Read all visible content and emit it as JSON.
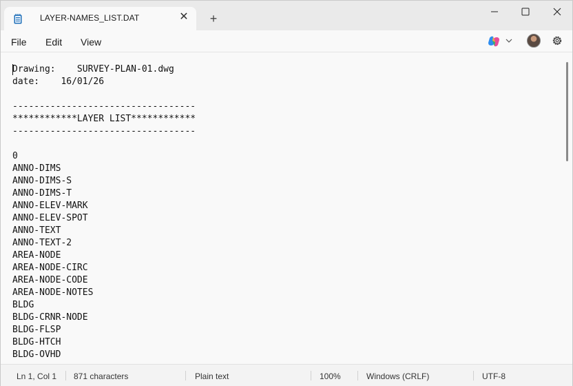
{
  "tab": {
    "title": "LAYER-NAMES_LIST.DAT",
    "close_glyph": "✕",
    "new_tab_glyph": "+"
  },
  "menu": {
    "file": "File",
    "edit": "Edit",
    "view": "View"
  },
  "document": {
    "lines": [
      "Drawing:    SURVEY-PLAN-01.dwg",
      "date:    16/01/26",
      "",
      "----------------------------------",
      "************LAYER LIST************",
      "----------------------------------",
      "",
      "0",
      "ANNO-DIMS",
      "ANNO-DIMS-S",
      "ANNO-DIMS-T",
      "ANNO-ELEV-MARK",
      "ANNO-ELEV-SPOT",
      "ANNO-TEXT",
      "ANNO-TEXT-2",
      "AREA-NODE",
      "AREA-NODE-CIRC",
      "AREA-NODE-CODE",
      "AREA-NODE-NOTES",
      "BLDG",
      "BLDG-CRNR-NODE",
      "BLDG-FLSP",
      "BLDG-HTCH",
      "BLDG-OVHD"
    ]
  },
  "status": {
    "position": "Ln 1, Col 1",
    "characters": "871 characters",
    "format": "Plain text",
    "zoom": "100%",
    "line_ending": "Windows (CRLF)",
    "encoding": "UTF-8"
  },
  "icons": {
    "app": "notepad-icon",
    "minimize": "minimize-icon",
    "maximize": "maximize-icon",
    "close": "close-icon",
    "copilot": "copilot-icon",
    "settings": "gear-icon"
  }
}
